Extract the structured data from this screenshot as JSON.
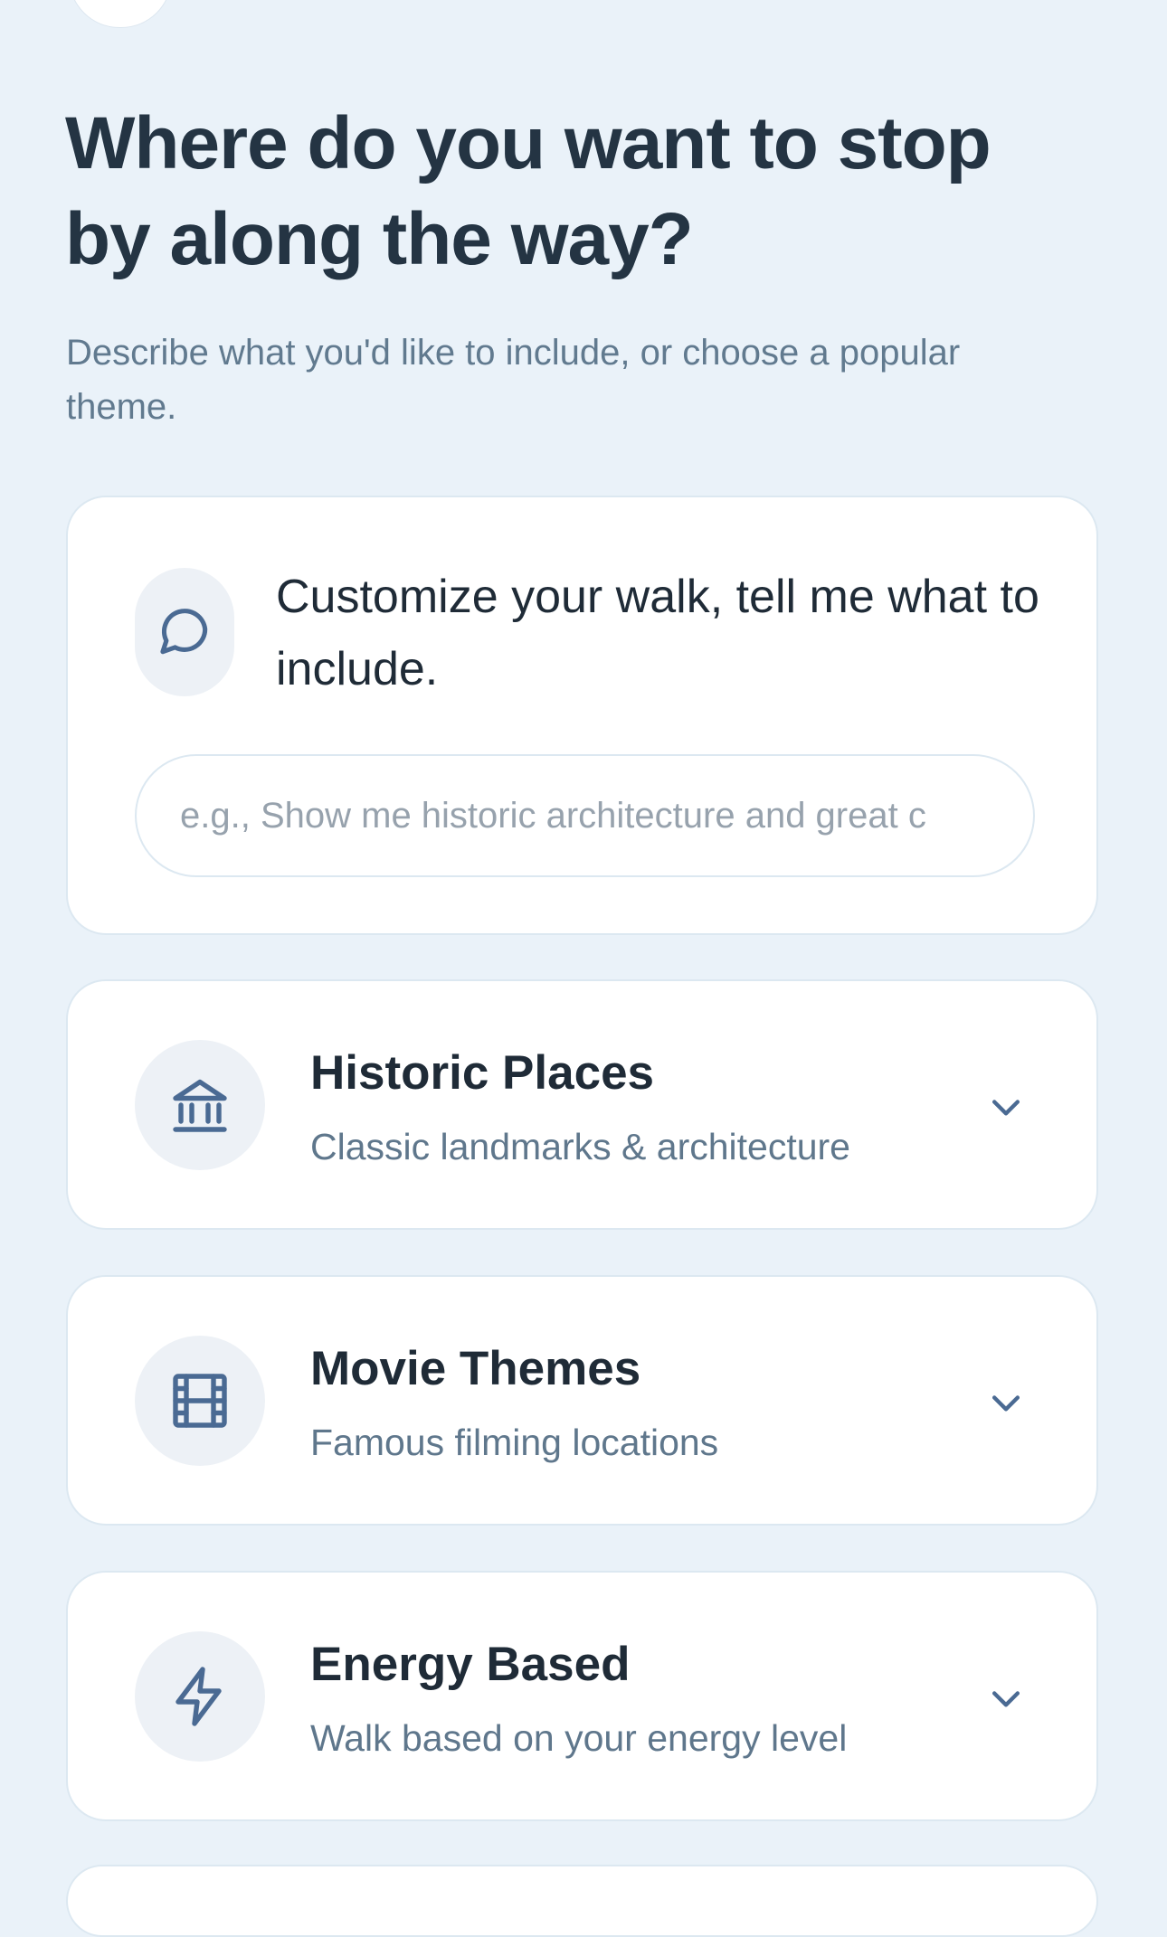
{
  "header": {
    "title": "Where do you want to stop by along the way?",
    "subtitle": "Describe what you'd like to include, or choose a popular theme."
  },
  "custom": {
    "icon": "chat-bubble-icon",
    "heading": "Customize your walk, tell me what to include.",
    "input_placeholder": "e.g., Show me historic architecture and great c",
    "input_value": ""
  },
  "themes": [
    {
      "title": "Historic Places",
      "description": "Classic landmarks & architecture",
      "icon": "landmark-icon"
    },
    {
      "title": "Movie Themes",
      "description": "Famous filming locations",
      "icon": "film-icon"
    },
    {
      "title": "Energy Based",
      "description": "Walk based on your energy level",
      "icon": "lightning-icon"
    }
  ],
  "colors": {
    "background": "#EAF2F9",
    "card": "#FFFFFF",
    "icon_accent": "#4A6A93",
    "title_text": "#243443",
    "secondary_text": "#5F778C"
  }
}
